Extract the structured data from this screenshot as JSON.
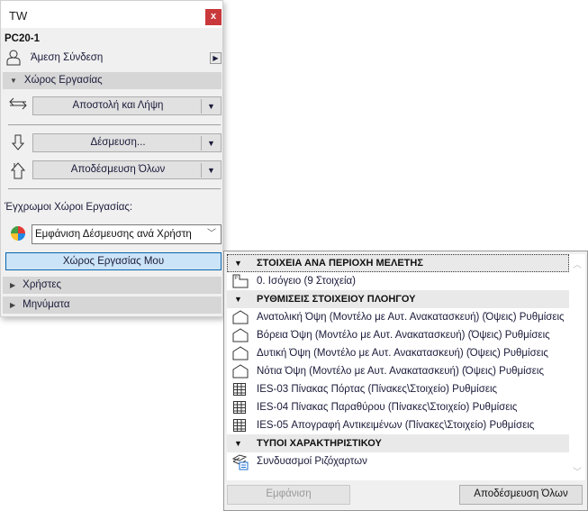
{
  "panel": {
    "title": "TW",
    "close": "x",
    "project": "PC20-1",
    "connection": "Άμεση Σύνδεση",
    "workspace_section": "Χώρος Εργασίας",
    "send_receive": "Αποστολή και Λήψη",
    "reserve": "Δέσμευση...",
    "release_all": "Αποδέσμευση Όλων",
    "colored_label": "Έγχρωμοι Χώροι Εργασίας:",
    "color_mode": "Εμφάνιση Δέσμευσης ανά Χρήστη",
    "my_workspace": "Χώρος Εργασίας Μου",
    "users": "Χρήστες",
    "messages": "Μηνύματα"
  },
  "popup": {
    "groups": [
      {
        "title": "ΣΤΟΙΧΕΙΑ ΑΝΑ ΠΕΡΙΟΧΗ ΜΕΛΕΤΗΣ",
        "items": [
          {
            "icon": "story",
            "label": "0. Ισόγειο (9 Στοιχεία)"
          }
        ]
      },
      {
        "title": "ΡΥΘΜΙΣΕΙΣ ΣΤΟΙΧΕΙΟΥ ΠΛΟΗΓΟΥ",
        "items": [
          {
            "icon": "elevation",
            "label": "Ανατολική Όψη (Μοντέλο με Αυτ. Ανακατασκευή) (Όψεις) Ρυθμίσεις"
          },
          {
            "icon": "elevation",
            "label": "Βόρεια Όψη (Μοντέλο με Αυτ. Ανακατασκευή) (Όψεις) Ρυθμίσεις"
          },
          {
            "icon": "elevation",
            "label": "Δυτική Όψη (Μοντέλο με Αυτ. Ανακατασκευή) (Όψεις) Ρυθμίσεις"
          },
          {
            "icon": "elevation",
            "label": "Νότια Όψη (Μοντέλο με Αυτ. Ανακατασκευή) (Όψεις) Ρυθμίσεις"
          },
          {
            "icon": "schedule",
            "label": "IES-03 Πίνακας Πόρτας (Πίνακες\\Στοιχείο) Ρυθμίσεις"
          },
          {
            "icon": "schedule",
            "label": "IES-04 Πίνακας Παραθύρου (Πίνακες\\Στοιχείο) Ρυθμίσεις"
          },
          {
            "icon": "schedule",
            "label": "IES-05 Απογραφή Αντικειμένων (Πίνακες\\Στοιχείο) Ρυθμίσεις"
          }
        ]
      },
      {
        "title": "ΤΥΠΟΙ ΧΑΡΑΚΤΗΡΙΣΤΙΚΟΥ",
        "items": [
          {
            "icon": "layer-combo",
            "label": "Συνδυασμοί Ριζόχαρτων"
          }
        ]
      }
    ],
    "show": "Εμφάνιση",
    "release_all": "Αποδέσμευση Όλων"
  }
}
